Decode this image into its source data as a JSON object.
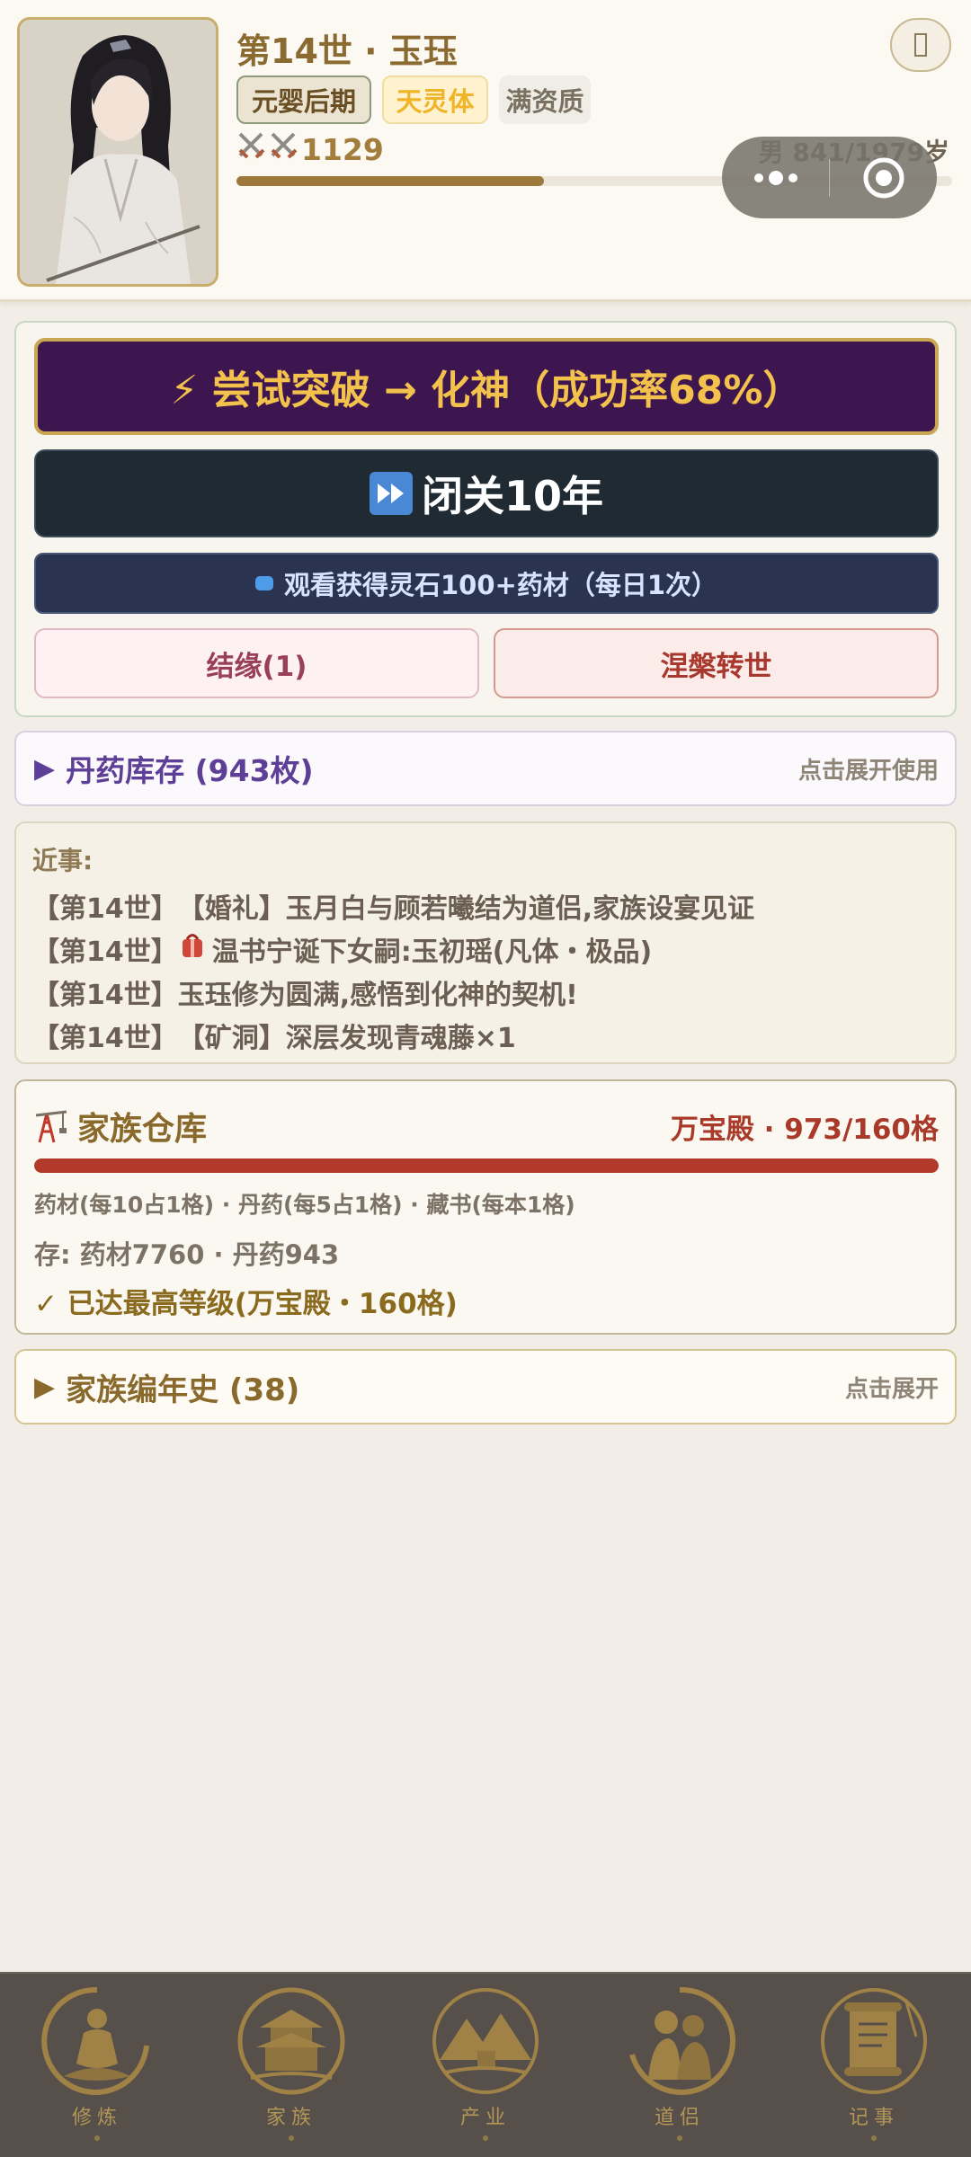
{
  "header": {
    "title": "第14世 · 玉珏",
    "realm_tag": "元婴后期",
    "body_tag": "天灵体",
    "aptitude_tag": "满资质",
    "combat_power": "1129",
    "age_text": "男 841/1979岁",
    "lifespan_progress": 0.43,
    "top_right_icon": "box-icon"
  },
  "actions": {
    "breakthrough": "⚡ 尝试突破 → 化神（成功率68%）",
    "seclusion": "闭关10年",
    "ad_reward": "观看获得灵石100+药材（每日1次）",
    "marriage": "结缘(1)",
    "reincarnate": "涅槃转世"
  },
  "pills": {
    "title": "丹药库存 (943枚)",
    "hint": "点击展开使用"
  },
  "events": {
    "title": "近事:",
    "items": [
      {
        "gen": "【第14世】",
        "text": "【婚礼】玉月白与顾若曦结为道侣,家族设宴见证"
      },
      {
        "gen": "【第14世】",
        "text": "温书宁诞下女嗣:玉初瑶(凡体・极品)"
      },
      {
        "gen": "【第14世】",
        "text": "玉珏修为圆满,感悟到化神的契机!"
      },
      {
        "gen": "【第14世】",
        "text": "【矿洞】深层发现青魂藤×1"
      }
    ]
  },
  "warehouse": {
    "title": "家族仓库",
    "capacity": "万宝殿 · 973/160格",
    "fill_ratio": 1.0,
    "rule": "药材(每10占1格) · 丹药(每5占1格) · 藏书(每本1格)",
    "stored": "存: 药材7760 · 丹药943",
    "max_level": "✓ 已达最高等级(万宝殿・160格)"
  },
  "chronicle": {
    "title": "家族编年史 (38)",
    "hint": "点击展开"
  },
  "nav": [
    {
      "label": "修炼",
      "icon": "meditation-icon"
    },
    {
      "label": "家族",
      "icon": "pavilion-icon"
    },
    {
      "label": "产业",
      "icon": "mountain-icon"
    },
    {
      "label": "道侣",
      "icon": "couple-icon"
    },
    {
      "label": "记事",
      "icon": "scroll-icon"
    }
  ],
  "colors": {
    "breakthrough_bg": "#3d164f",
    "accent_gold": "#c9a651",
    "warehouse_bar": "#b23a2a"
  }
}
